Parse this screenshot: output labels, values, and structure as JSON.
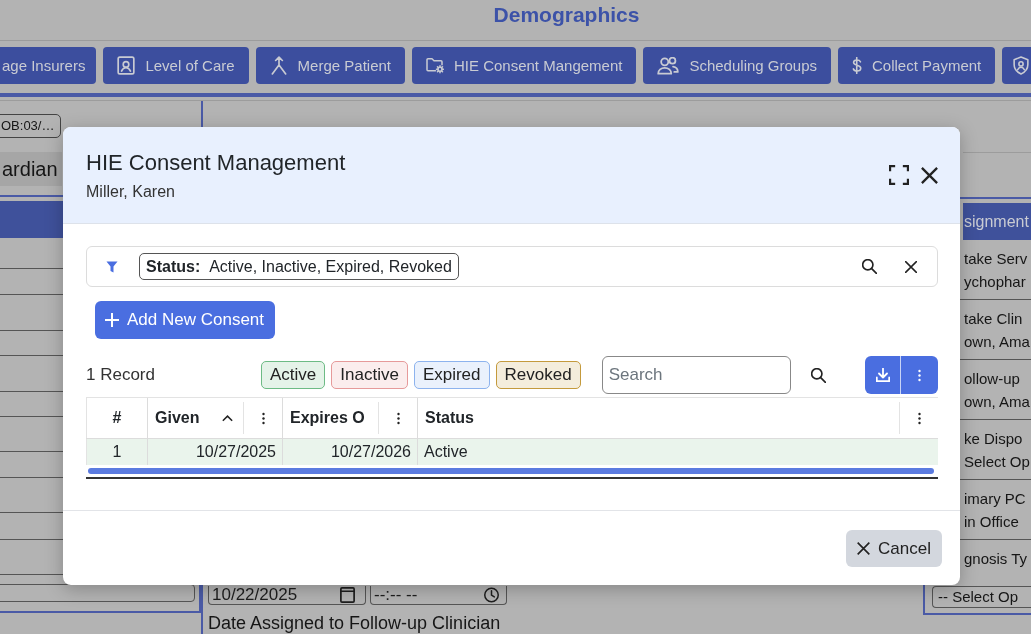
{
  "page": {
    "title": "Demographics",
    "toolbar": [
      {
        "label": "age Insurers"
      },
      {
        "label": "Level of Care"
      },
      {
        "label": "Merge Patient"
      },
      {
        "label": "HIE Consent Mangement"
      },
      {
        "label": "Scheduling Groups"
      },
      {
        "label": "Collect Payment"
      }
    ],
    "patient_chip": "OB:03/…",
    "left_panel": {
      "tab": "ardian"
    },
    "middle_panel": {
      "date_field": {
        "value": "10/22/2025"
      },
      "time_field": {
        "value": "--:-- --"
      },
      "label": "Date Assigned to Follow-up Clinician"
    },
    "right_panel": {
      "header": "signment",
      "fields": [
        {
          "kind": "text",
          "label": "take Serv",
          "value": "ychophar"
        },
        {
          "kind": "text",
          "label": "take Clin",
          "value": "own, Ama"
        },
        {
          "kind": "text",
          "label": "ollow-up",
          "value": "own, Ama"
        },
        {
          "kind": "text",
          "label": "ke Dispo",
          "value": "Select Op"
        },
        {
          "kind": "text",
          "label": "imary PC",
          "value": "in Office"
        },
        {
          "kind": "select",
          "label": "gnosis Ty",
          "value": "-- Select Op"
        }
      ]
    }
  },
  "dialog": {
    "title": "HIE Consent Management",
    "subtitle": "Miller, Karen",
    "filter": {
      "label": "Status:",
      "value": "Active, Inactive, Expired, Revoked"
    },
    "add_button": "Add New Consent",
    "record_count": "1 Record",
    "legend": [
      {
        "label": "Active",
        "color": "#6dbb85"
      },
      {
        "label": "Inactive",
        "color": "#e69a9a"
      },
      {
        "label": "Expired",
        "color": "#8db3ee"
      },
      {
        "label": "Revoked",
        "color": "#c49a3c"
      }
    ],
    "search": {
      "placeholder": "Search"
    },
    "table": {
      "columns": [
        {
          "label": "#",
          "sorted": false,
          "menu": false
        },
        {
          "label": "Given",
          "sorted": true,
          "menu": true
        },
        {
          "label": "Expires O",
          "sorted": false,
          "menu": true
        },
        {
          "label": "Status",
          "sorted": false,
          "menu": true
        }
      ],
      "rows": [
        {
          "highlighted": true,
          "cells": [
            "1",
            "10/27/2025",
            "10/27/2026",
            "Active"
          ]
        }
      ]
    },
    "cancel_button": "Cancel"
  }
}
